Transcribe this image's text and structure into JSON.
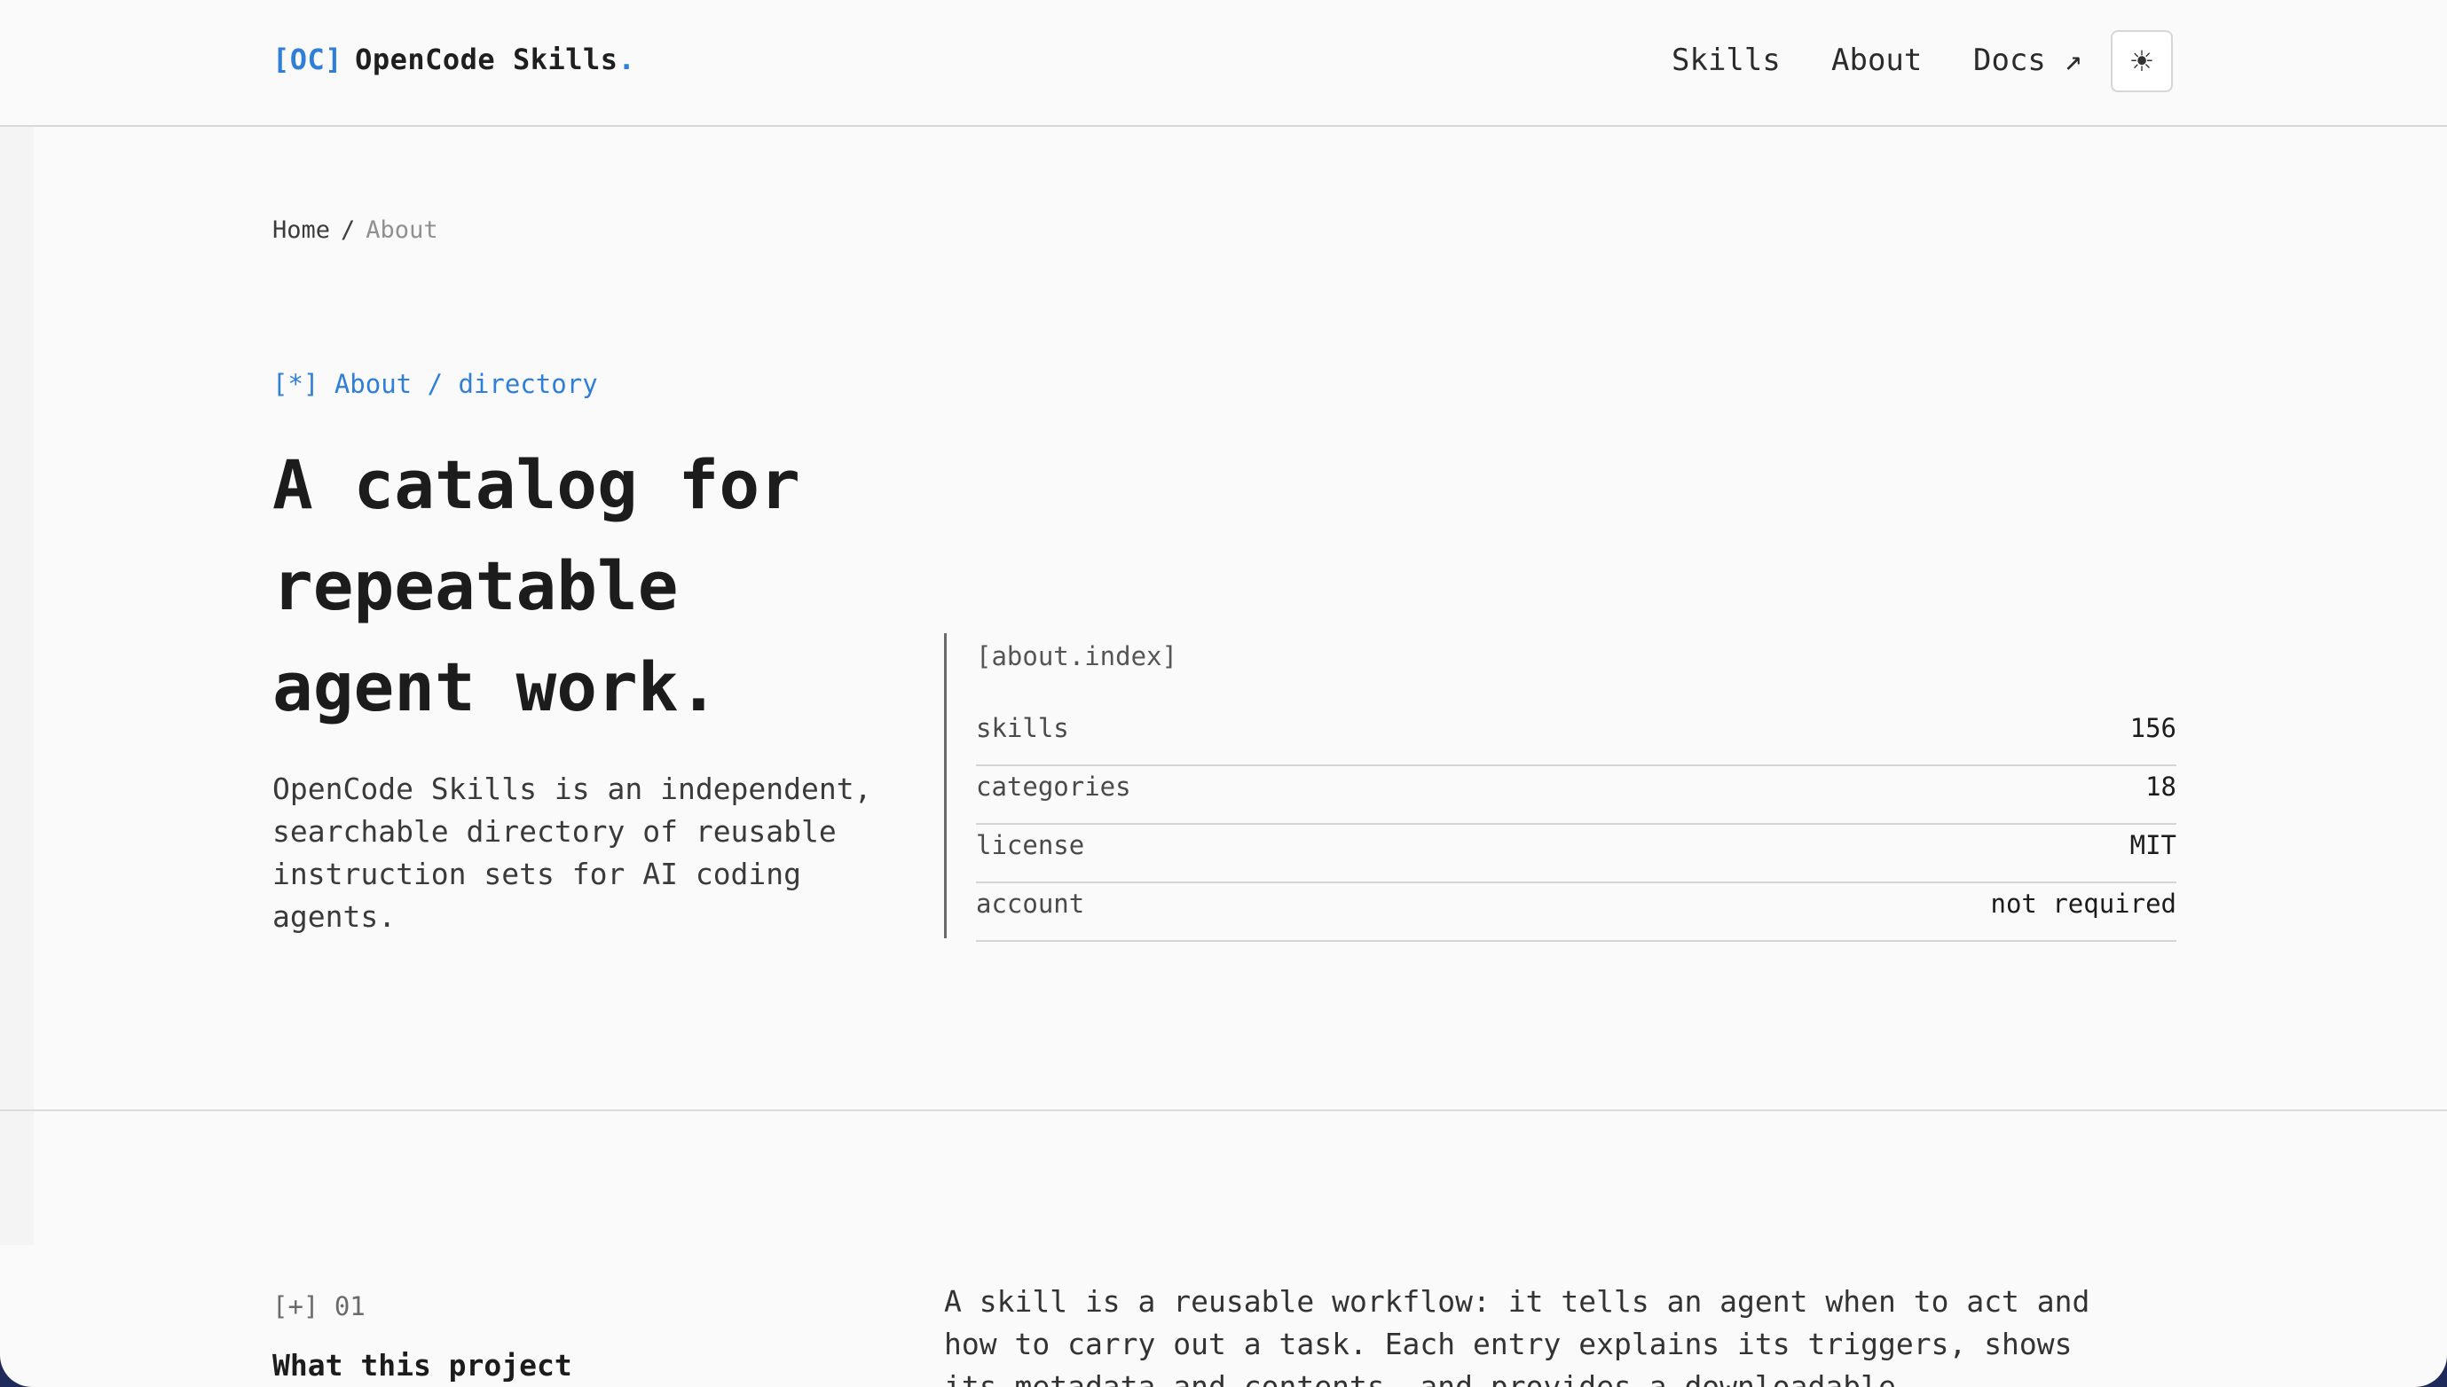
{
  "header": {
    "brand_tag": "[OC]",
    "brand_name": "OpenCode Skills",
    "brand_dot": ".",
    "nav": {
      "skills": "Skills",
      "about": "About",
      "docs": "Docs ↗"
    },
    "theme_toggle_icon": "☀"
  },
  "breadcrumb": {
    "home": "Home",
    "separator": "/",
    "current": "About"
  },
  "hero": {
    "eyebrow": "[*] About / directory",
    "title": "A catalog for repeatable agent work.",
    "description": "OpenCode Skills is an independent, searchable directory of reusable instruction sets for AI coding agents."
  },
  "index": {
    "title": "[about.index]",
    "rows": [
      {
        "key": "skills",
        "value": "156"
      },
      {
        "key": "categories",
        "value": "18"
      },
      {
        "key": "license",
        "value": "MIT"
      },
      {
        "key": "account",
        "value": "not required"
      }
    ]
  },
  "section_01": {
    "number": "[+] 01",
    "title": "What this project",
    "body": "A skill is a reusable workflow: it tells an agent when to act and how to carry out a task. Each entry explains its triggers, shows its metadata and contents, and provides a downloadable"
  },
  "colors": {
    "accent": "#2f7fd9",
    "background": "#fafafa",
    "text": "#1f1f1f"
  },
  "icons": {
    "theme_toggle": "sun-icon",
    "external_link": "arrow-up-right-icon"
  }
}
